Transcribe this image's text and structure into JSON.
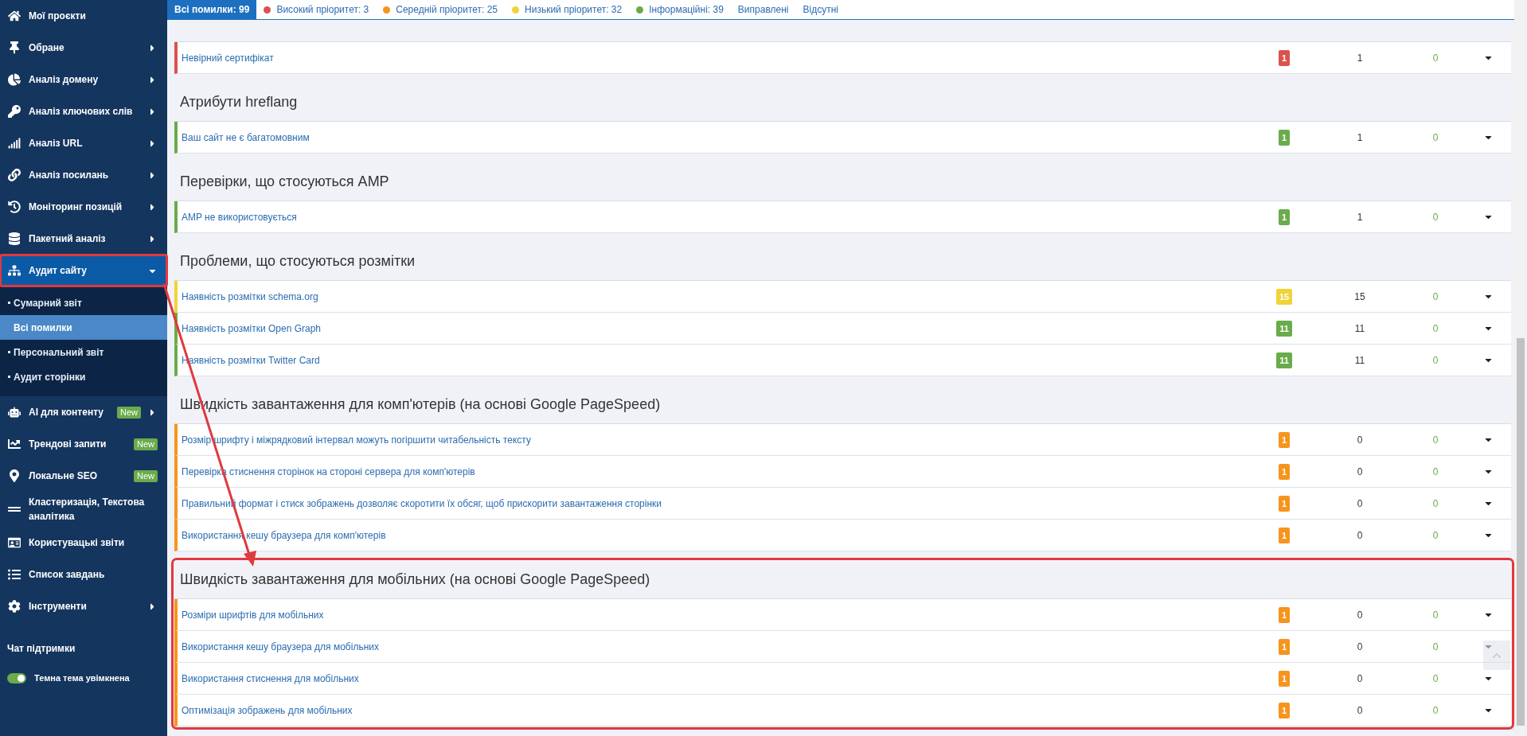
{
  "top_tabs": [
    {
      "label": "Всі помилки: 99",
      "selected": true
    },
    {
      "label": "Високий пріоритет: 3",
      "selected": false,
      "color": "#d9534f"
    },
    {
      "label": "Середній пріоритет: 25",
      "selected": false,
      "color": "#f7941d"
    },
    {
      "label": "Низький пріоритет: 32",
      "selected": false,
      "color": "#f0d33a"
    },
    {
      "label": "Інформаційні: 39",
      "selected": false,
      "color": "#6aab4c"
    },
    {
      "label": "Виправлені",
      "selected": false
    },
    {
      "label": "Відсутні",
      "selected": false
    }
  ],
  "sidebar": {
    "items": [
      {
        "label": "Мої проєкти",
        "submenu": false,
        "expanded": false
      },
      {
        "label": "Обране",
        "submenu": true,
        "expanded": false
      },
      {
        "label": "Аналіз домену",
        "submenu": true,
        "expanded": false
      },
      {
        "label": "Аналіз ключових слів",
        "submenu": true,
        "expanded": false
      },
      {
        "label": "Аналіз URL",
        "submenu": true,
        "expanded": false
      },
      {
        "label": "Аналіз посилань",
        "submenu": true,
        "expanded": false
      },
      {
        "label": "Моніторинг позицій",
        "submenu": true,
        "expanded": false
      },
      {
        "label": "Пакетний аналіз",
        "submenu": true,
        "expanded": false
      },
      {
        "label": "Аудит сайту",
        "submenu": true,
        "expanded": true,
        "children": [
          {
            "label": "Сумарний звіт",
            "selected": false
          },
          {
            "label": "Всі помилки",
            "selected": true
          },
          {
            "label": "Персональний звіт",
            "selected": false
          },
          {
            "label": "Аудит сторінки",
            "selected": false
          }
        ]
      },
      {
        "label": "AI для контенту",
        "submenu": true,
        "expanded": false,
        "badge": "New"
      },
      {
        "label": "Трендові запити",
        "submenu": false,
        "expanded": false,
        "badge": "New"
      },
      {
        "label": "Локальне SEO",
        "submenu": false,
        "expanded": false,
        "badge": "New"
      },
      {
        "label": "Кластеризація, Текстова аналітика",
        "submenu": false,
        "expanded": false
      },
      {
        "label": "Користувацькі звіти",
        "submenu": false,
        "expanded": false
      },
      {
        "label": "Список завдань",
        "submenu": false,
        "expanded": false
      },
      {
        "label": "Інструменти",
        "submenu": true,
        "expanded": false
      }
    ],
    "support_chat": "Чат підтримки",
    "theme_toggle": {
      "label": "Темна тема увімкнена",
      "on": true
    }
  },
  "sections": [
    {
      "highlighted": false,
      "rows": [
        {
          "label": "Невірний сертифікат",
          "color": "#d9534f",
          "badge": "1",
          "count": "1",
          "fixed": "0"
        }
      ]
    },
    {
      "title": "Атрибути hreflang",
      "highlighted": false,
      "rows": [
        {
          "label": "Ваш сайт не є багатомовним",
          "color": "#6aab4c",
          "badge": "1",
          "count": "1",
          "fixed": "0"
        }
      ]
    },
    {
      "title": "Перевірки, що стосуються AMP",
      "highlighted": false,
      "rows": [
        {
          "label": "AMP не використовується",
          "color": "#6aab4c",
          "badge": "1",
          "count": "1",
          "fixed": "0"
        }
      ]
    },
    {
      "title": "Проблеми, що стосуються розмітки",
      "highlighted": false,
      "rows": [
        {
          "label": "Наявність розмітки schema.org",
          "color": "#f0d33a",
          "badge": "15",
          "count": "15",
          "fixed": "0"
        },
        {
          "label": "Наявність розмітки Open Graph",
          "color": "#6aab4c",
          "badge": "11",
          "count": "11",
          "fixed": "0"
        },
        {
          "label": "Наявність розмітки Twitter Card",
          "color": "#6aab4c",
          "badge": "11",
          "count": "11",
          "fixed": "0"
        }
      ]
    },
    {
      "title": "Швидкість завантаження для комп'ютерів (на основі Google PageSpeed)",
      "highlighted": false,
      "rows": [
        {
          "label": "Розмір шрифту і міжрядковий інтервал можуть погіршити читабельність тексту",
          "color": "#f7941d",
          "badge": "1",
          "count": "0",
          "fixed": "0"
        },
        {
          "label": "Перевірка стиснення сторінок на стороні сервера для комп'ютерів",
          "color": "#f7941d",
          "badge": "1",
          "count": "0",
          "fixed": "0"
        },
        {
          "label": "Правильний формат і стиск зображень дозволяє скоротити їх обсяг, щоб прискорити завантаження сторінки",
          "color": "#f7941d",
          "badge": "1",
          "count": "0",
          "fixed": "0"
        },
        {
          "label": "Використання кешу браузера для комп'ютерів",
          "color": "#f7941d",
          "badge": "1",
          "count": "0",
          "fixed": "0"
        }
      ]
    },
    {
      "title": "Швидкість завантаження для мобільних (на основі Google PageSpeed)",
      "highlighted": true,
      "rows": [
        {
          "label": "Розміри шрифтів для мобільних",
          "color": "#f7941d",
          "badge": "1",
          "count": "0",
          "fixed": "0"
        },
        {
          "label": "Використання кешу браузера для мобільних",
          "color": "#f7941d",
          "badge": "1",
          "count": "0",
          "fixed": "0"
        },
        {
          "label": "Використання стиснення для мобільних",
          "color": "#f7941d",
          "badge": "1",
          "count": "0",
          "fixed": "0"
        },
        {
          "label": "Оптимізація зображень для мобільних",
          "color": "#f7941d",
          "badge": "1",
          "count": "0",
          "fixed": "0"
        }
      ]
    }
  ]
}
